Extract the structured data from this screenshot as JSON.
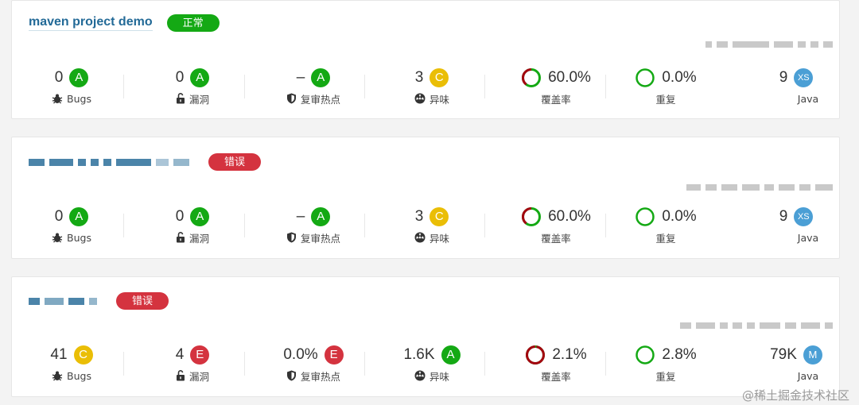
{
  "projects": [
    {
      "name": "maven project demo",
      "status": "正常",
      "status_type": "ok",
      "bugs": {
        "value": "0",
        "rating": "A",
        "label": "Bugs"
      },
      "vulnerabilities": {
        "value": "0",
        "rating": "A",
        "label": "漏洞"
      },
      "hotspots": {
        "value": "–",
        "rating": "A",
        "label": "复审热点"
      },
      "code_smells": {
        "value": "3",
        "rating": "C",
        "label": "异味"
      },
      "coverage": {
        "value": "60.0%",
        "label": "覆盖率",
        "fraction": 0.6
      },
      "duplications": {
        "value": "0.0%",
        "label": "重复"
      },
      "lines": {
        "value": "9",
        "size": "XS",
        "label": "Java"
      }
    },
    {
      "name": "",
      "status": "错误",
      "status_type": "err",
      "bugs": {
        "value": "0",
        "rating": "A",
        "label": "Bugs"
      },
      "vulnerabilities": {
        "value": "0",
        "rating": "A",
        "label": "漏洞"
      },
      "hotspots": {
        "value": "–",
        "rating": "A",
        "label": "复审热点"
      },
      "code_smells": {
        "value": "3",
        "rating": "C",
        "label": "异味"
      },
      "coverage": {
        "value": "60.0%",
        "label": "覆盖率",
        "fraction": 0.6
      },
      "duplications": {
        "value": "0.0%",
        "label": "重复"
      },
      "lines": {
        "value": "9",
        "size": "XS",
        "label": "Java"
      }
    },
    {
      "name": "",
      "status": "错误",
      "status_type": "err",
      "bugs": {
        "value": "41",
        "rating": "C",
        "label": "Bugs"
      },
      "vulnerabilities": {
        "value": "4",
        "rating": "E",
        "label": "漏洞"
      },
      "hotspots": {
        "value": "0.0%",
        "rating": "E",
        "label": "复审热点"
      },
      "code_smells": {
        "value": "1.6K",
        "rating": "A",
        "label": "异味"
      },
      "coverage": {
        "value": "2.1%",
        "label": "覆盖率",
        "fraction": 0.021
      },
      "duplications": {
        "value": "2.8%",
        "label": "重复"
      },
      "lines": {
        "value": "79K",
        "size": "M",
        "label": "Java"
      }
    }
  ],
  "watermark": "@稀土掘金技术社区"
}
